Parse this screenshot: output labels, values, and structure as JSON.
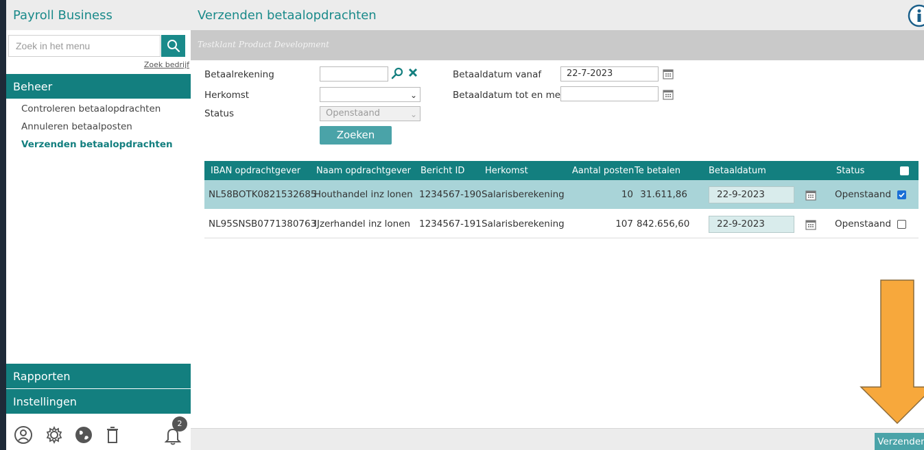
{
  "app": {
    "title": "Payroll Business"
  },
  "sidebar": {
    "search_placeholder": "Zoek in het menu",
    "zoek_bedrijf": "Zoek bedrijf",
    "sections": {
      "beheer": "Beheer",
      "rapporten": "Rapporten",
      "instellingen": "Instellingen"
    },
    "items": [
      {
        "label": "Controleren betaalopdrachten",
        "active": false
      },
      {
        "label": "Annuleren betaalposten",
        "active": false
      },
      {
        "label": "Verzenden betaalopdrachten",
        "active": true
      }
    ],
    "bottom_icons": [
      "user-support-icon",
      "gear-icon",
      "globe-icon",
      "trash-icon",
      "bell-icon"
    ],
    "notification_count": "2"
  },
  "main": {
    "title": "Verzenden betaalopdrachten",
    "client": "Testklant Product Development",
    "filters": {
      "betaalrekening_label": "Betaalrekening",
      "betaalrekening_value": "",
      "herkomst_label": "Herkomst",
      "herkomst_value": "",
      "status_label": "Status",
      "status_value": "Openstaand",
      "datum_vanaf_label": "Betaaldatum vanaf",
      "datum_vanaf_value": "22-7-2023",
      "datum_tot_label": "Betaaldatum tot en met",
      "datum_tot_value": "",
      "zoeken": "Zoeken"
    },
    "table": {
      "headers": {
        "iban": "IBAN opdrachtgever",
        "naam": "Naam opdrachtgever",
        "bericht": "Bericht ID",
        "herkomst": "Herkomst",
        "aantal": "Aantal posten",
        "bedrag": "Te betalen",
        "datum": "Betaaldatum",
        "status": "Status"
      },
      "rows": [
        {
          "iban": "NL58BOTK0821532685",
          "naam": "Houthandel inz lonen",
          "bericht": "1234567-190",
          "herkomst": "Salarisberekening",
          "aantal": "10",
          "bedrag": "31.611,86",
          "datum": "22-9-2023",
          "status": "Openstaand",
          "checked": true
        },
        {
          "iban": "NL95SNSB0771380763",
          "naam": "IJzerhandel inz lonen",
          "bericht": "1234567-191",
          "herkomst": "Salarisberekening",
          "aantal": "107",
          "bedrag": "842.656,60",
          "datum": "22-9-2023",
          "status": "Openstaand",
          "checked": false
        }
      ]
    },
    "verzenden": "Verzenden"
  },
  "colors": {
    "accent": "#137f7f",
    "accent_light": "#4aa3a8",
    "row_selected": "#a9d4d8",
    "arrow": "#f7a83c"
  }
}
